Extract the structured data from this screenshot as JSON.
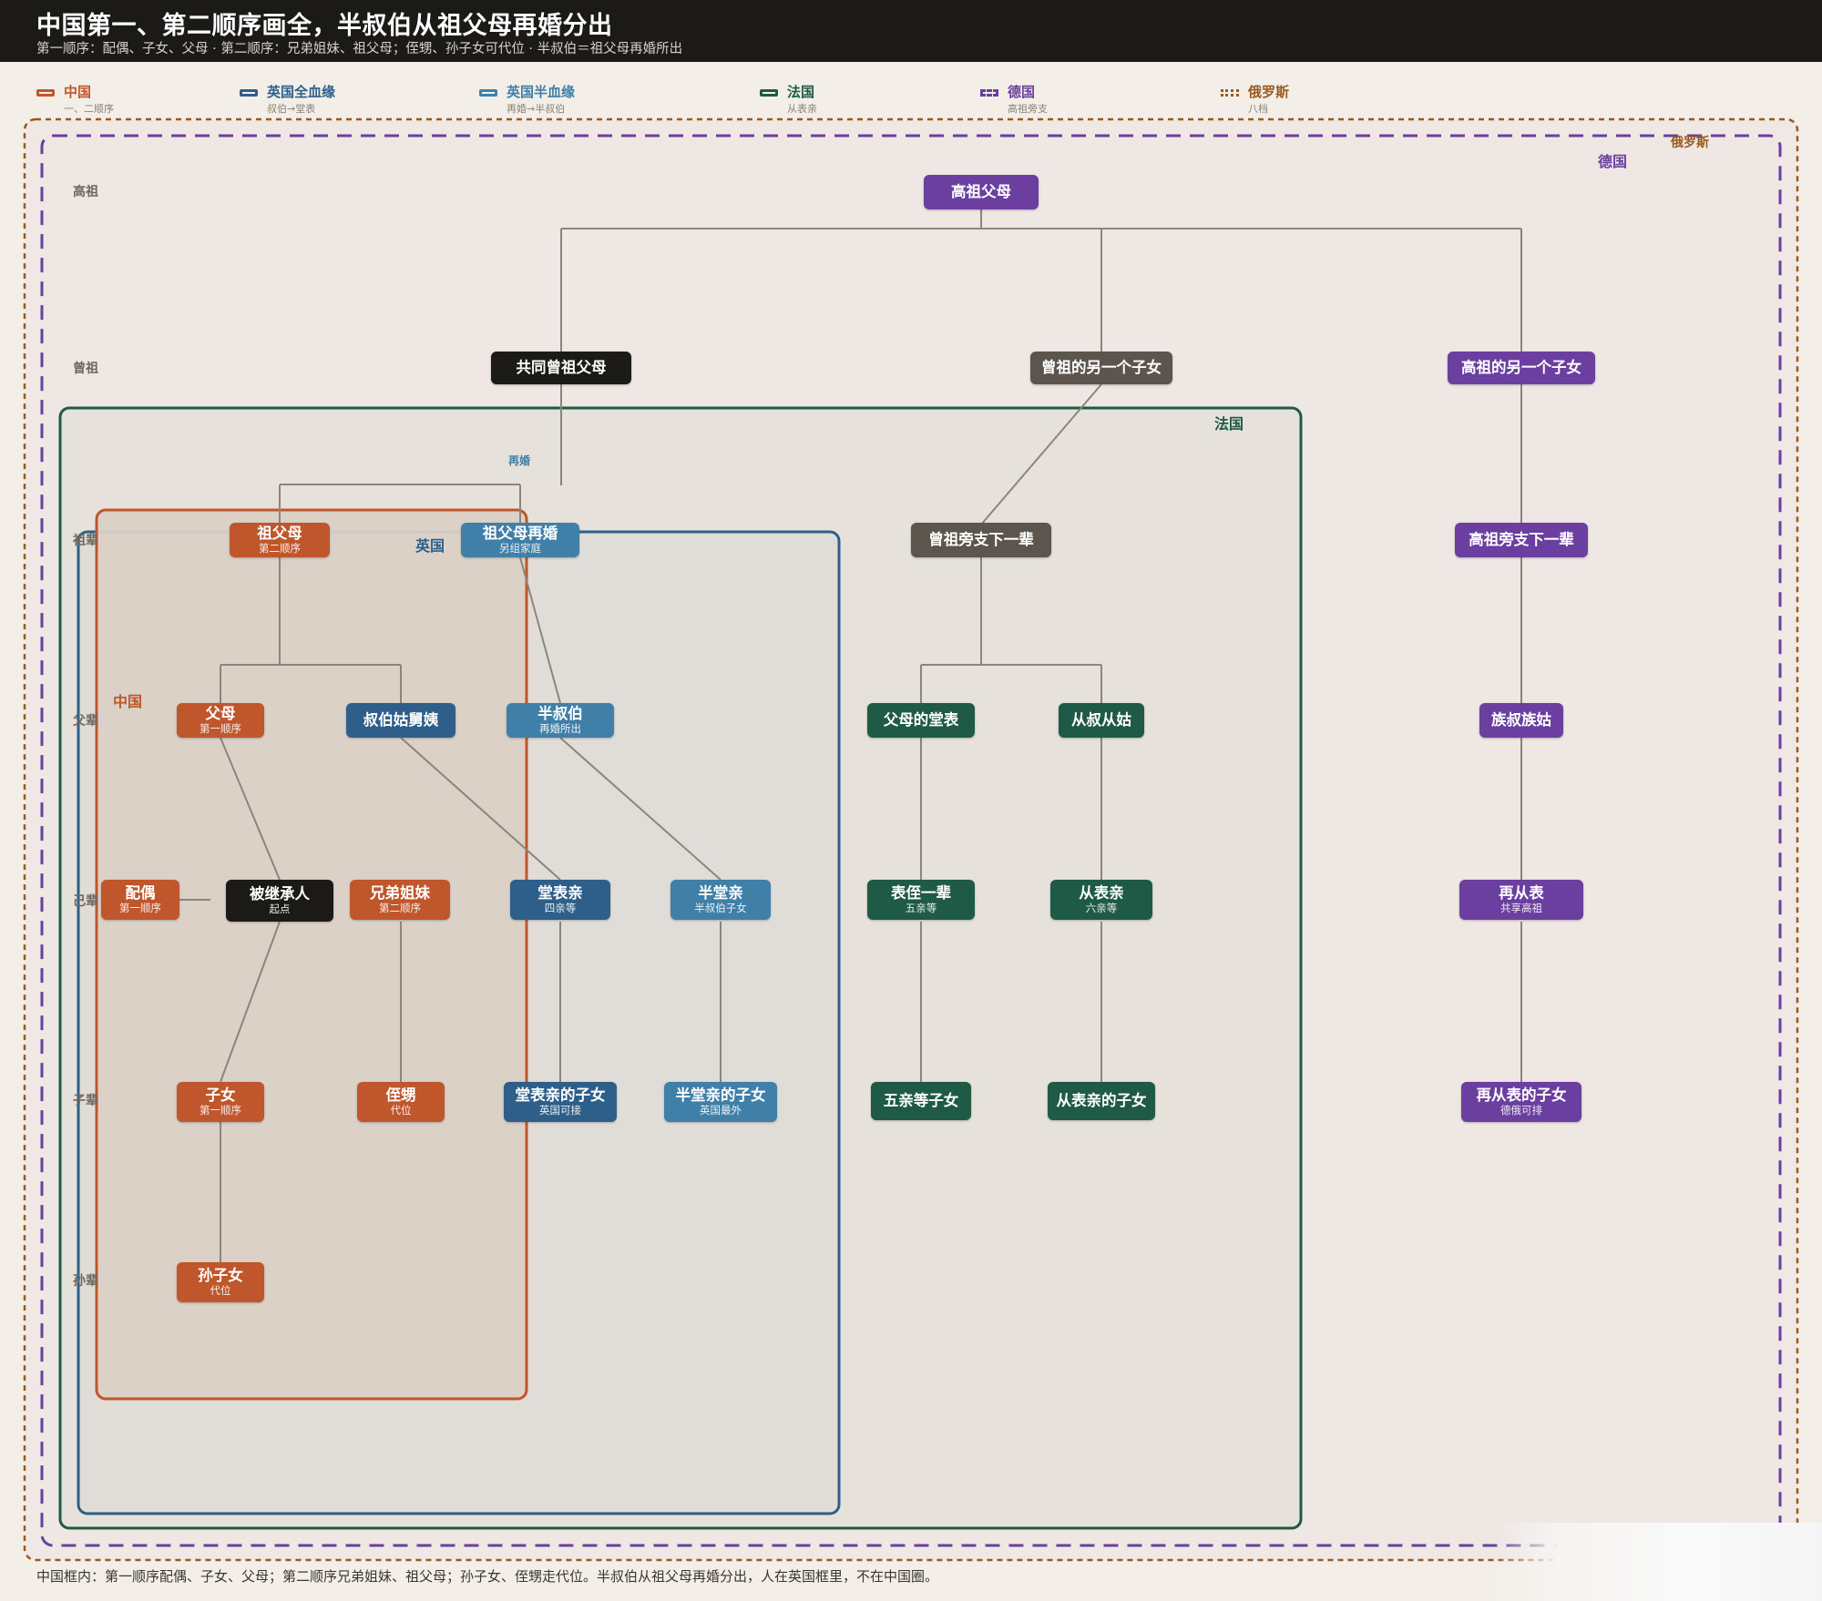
{
  "header": {
    "title": "中国第一、第二顺序画全，半叔伯从祖父母再婚分出",
    "subtitle": "第一顺序：配偶、子女、父母 · 第二顺序：兄弟姐妹、祖父母；侄甥、孙子女可代位 · 半叔伯＝祖父母再婚所出"
  },
  "legend": [
    {
      "label": "中国",
      "desc": "一、二顺序",
      "color": "#c0562b",
      "style": "solid"
    },
    {
      "label": "英国全血缘",
      "desc": "叔伯→堂表",
      "color": "#2e5f8a",
      "style": "solid"
    },
    {
      "label": "英国半血缘",
      "desc": "再婚→半叔伯",
      "color": "#3f7fa8",
      "style": "solid"
    },
    {
      "label": "法国",
      "desc": "从表亲",
      "color": "#1f5a46",
      "style": "solid"
    },
    {
      "label": "德国",
      "desc": "高祖旁支",
      "color": "#6b3fa0",
      "style": "dashed"
    },
    {
      "label": "俄罗斯",
      "desc": "八档",
      "color": "#9a5a1f",
      "style": "dotted"
    }
  ],
  "regions": {
    "russia": {
      "label": "俄罗斯",
      "color": "#9a5a1f"
    },
    "germany": {
      "label": "德国",
      "color": "#6b3fa0"
    },
    "france": {
      "label": "法国",
      "color": "#1f5a46"
    },
    "uk": {
      "label": "英国",
      "color": "#2e5f8a"
    },
    "china": {
      "label": "中国",
      "color": "#c0562b"
    }
  },
  "generations": [
    "高祖",
    "曾祖",
    "祖辈",
    "父辈",
    "己辈",
    "子辈",
    "孙辈"
  ],
  "remarry_label": "再婚",
  "colors": {
    "china": "#c0562b",
    "uk_full": "#2e5f8a",
    "uk_half": "#3f7fa8",
    "france": "#1f5a46",
    "germany": "#6b3fa0",
    "black": "#1c1a17",
    "gray": "#5b554e",
    "line": "#8c857a"
  },
  "nodes": {
    "gaozu": {
      "label": "高祖父母",
      "sub": ""
    },
    "common_zengzu": {
      "label": "共同曾祖父母",
      "sub": ""
    },
    "zengzu_other": {
      "label": "曾祖的另一个子女",
      "sub": ""
    },
    "gaozu_other": {
      "label": "高祖的另一个子女",
      "sub": ""
    },
    "grandparents": {
      "label": "祖父母",
      "sub": "第二顺序"
    },
    "grandparents_remarry": {
      "label": "祖父母再婚",
      "sub": "另组家庭"
    },
    "zengzu_branch": {
      "label": "曾祖旁支下一辈",
      "sub": ""
    },
    "gaozu_branch": {
      "label": "高祖旁支下一辈",
      "sub": ""
    },
    "parents": {
      "label": "父母",
      "sub": "第一顺序"
    },
    "uncles_aunts": {
      "label": "叔伯姑舅姨",
      "sub": ""
    },
    "half_uncle": {
      "label": "半叔伯",
      "sub": "再婚所出"
    },
    "parents_cousins": {
      "label": "父母的堂表",
      "sub": ""
    },
    "cong_shu": {
      "label": "从叔从姑",
      "sub": ""
    },
    "zu_shu": {
      "label": "族叔族姑",
      "sub": ""
    },
    "spouse": {
      "label": "配偶",
      "sub": "第一顺序"
    },
    "decedent": {
      "label": "被继承人",
      "sub": "起点"
    },
    "siblings": {
      "label": "兄弟姐妹",
      "sub": "第二顺序"
    },
    "cousins": {
      "label": "堂表亲",
      "sub": "四亲等"
    },
    "half_cousins": {
      "label": "半堂亲",
      "sub": "半叔伯子女"
    },
    "biao_zhi": {
      "label": "表侄一辈",
      "sub": "五亲等"
    },
    "cong_biao": {
      "label": "从表亲",
      "sub": "六亲等"
    },
    "zai_cong_biao": {
      "label": "再从表",
      "sub": "共享高祖"
    },
    "children": {
      "label": "子女",
      "sub": "第一顺序"
    },
    "nephews": {
      "label": "侄甥",
      "sub": "代位"
    },
    "cousins_children": {
      "label": "堂表亲的子女",
      "sub": "英国可接"
    },
    "half_cousins_children": {
      "label": "半堂亲的子女",
      "sub": "英国最外"
    },
    "fifth_degree_children": {
      "label": "五亲等子女",
      "sub": ""
    },
    "cong_biao_children": {
      "label": "从表亲的子女",
      "sub": ""
    },
    "zai_cong_biao_children": {
      "label": "再从表的子女",
      "sub": "德俄可排"
    },
    "grandchildren": {
      "label": "孙子女",
      "sub": "代位"
    }
  },
  "footer": "中国框内：第一顺序配偶、子女、父母；第二顺序兄弟姐妹、祖父母；孙子女、侄甥走代位。半叔伯从祖父母再婚分出，人在英国框里，不在中国圈。"
}
